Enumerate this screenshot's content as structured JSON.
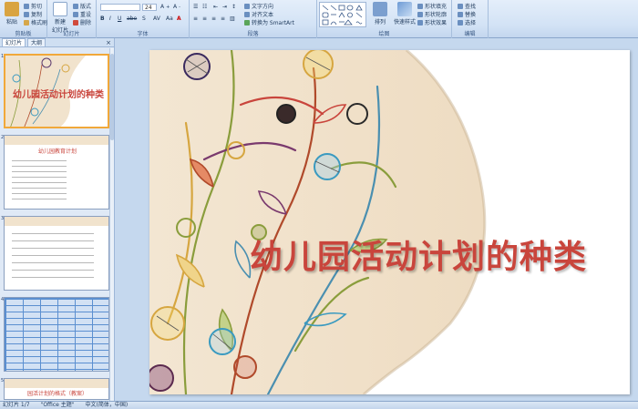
{
  "ribbon": {
    "clipboard": {
      "paste": "粘贴",
      "cut": "剪切",
      "copy": "复制",
      "format_painter": "格式刷",
      "label": "剪贴板"
    },
    "slides": {
      "new_slide": "新建\n幻灯片",
      "layout": "版式",
      "reset": "重设",
      "delete": "删除",
      "label": "幻灯片"
    },
    "font": {
      "font_size": "24",
      "label": "字体"
    },
    "paragraph": {
      "text_direction": "文字方向",
      "align_text": "对齐文本",
      "smartart": "转换为 SmartArt",
      "label": "段落"
    },
    "drawing": {
      "arrange": "排列",
      "quick_styles": "快速样式",
      "shape_fill": "形状填充",
      "shape_outline": "形状轮廓",
      "shape_effects": "形状效果",
      "label": "绘图"
    },
    "editing": {
      "find": "查找",
      "replace": "替换",
      "select": "选择",
      "label": "编辑"
    }
  },
  "panel": {
    "tabs": [
      "幻灯片",
      "大纲"
    ],
    "close": "×",
    "thumbnails": [
      {
        "num": "1",
        "title": "幼儿园活动计划的种类"
      },
      {
        "num": "2",
        "title": "幼儿园教育计划"
      },
      {
        "num": "3",
        "title": ""
      },
      {
        "num": "4",
        "title": ""
      },
      {
        "num": "5",
        "title": "园活计划的格式（教案）"
      }
    ]
  },
  "slide": {
    "title": "幼儿园活动计划的种类"
  },
  "status": {
    "slide_info": "幻灯片 1/7",
    "theme": "\"Office 主题\"",
    "language": "中文(简体，中国)"
  },
  "colors": {
    "title": "#c9453c",
    "ribbon": "#d2e2f5",
    "background": "#c5d8ee",
    "selection": "#f1a83a"
  }
}
